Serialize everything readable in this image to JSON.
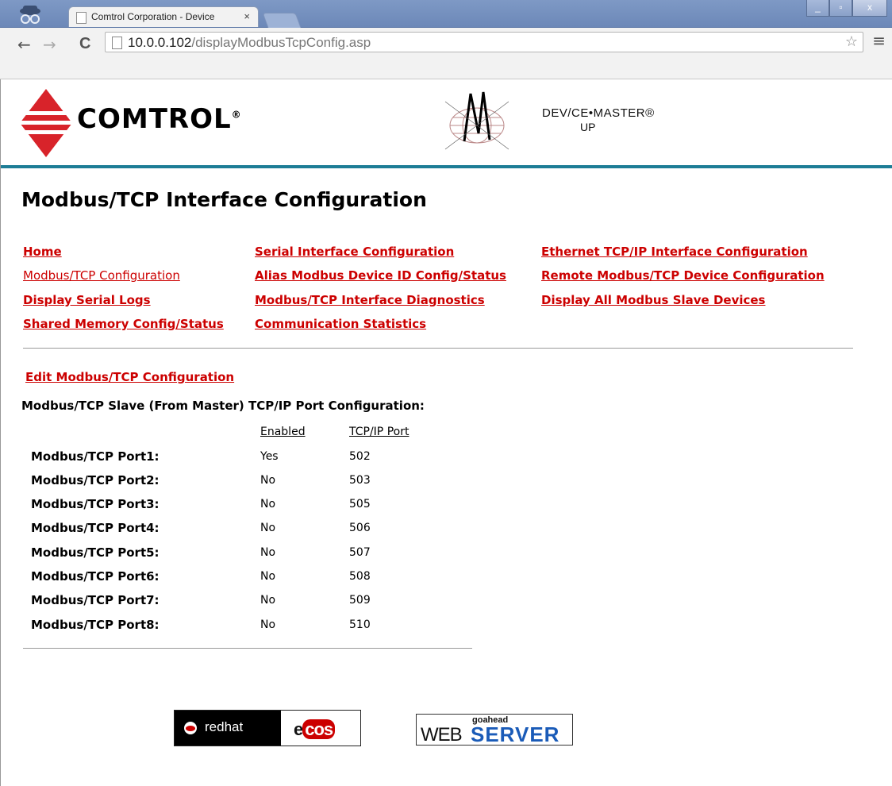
{
  "browser": {
    "tab_title": "Comtrol Corporation - Device",
    "tab_close": "×",
    "url_host": "10.0.0.102",
    "url_path": "/displayModbusTcpConfig.asp",
    "back": "←",
    "forward": "→",
    "reload": "C",
    "star": "☆",
    "menu": "≡",
    "win_min": "_",
    "win_max": "▫",
    "win_close": "x"
  },
  "header": {
    "brand": "COMTROL",
    "brand_mark": "®",
    "product_line1": "DEV/CE•MASTER®",
    "product_line2": "UP"
  },
  "page_title": "Modbus/TCP Interface Configuration",
  "nav_links": [
    {
      "label": "Home"
    },
    {
      "label": "Modbus/TCP Configuration"
    },
    {
      "label": "Display Serial Logs"
    },
    {
      "label": "Shared Memory Config/Status"
    },
    {
      "label": "Serial Interface Configuration"
    },
    {
      "label": "Alias Modbus Device ID Config/Status"
    },
    {
      "label": "Modbus/TCP Interface Diagnostics"
    },
    {
      "label": "Communication Statistics"
    },
    {
      "label": "Ethernet TCP/IP Interface Configuration"
    },
    {
      "label": "Remote Modbus/TCP Device Configuration"
    },
    {
      "label": "Display All Modbus Slave Devices"
    }
  ],
  "edit_link": "Edit Modbus/TCP Configuration",
  "section_label": "Modbus/TCP Slave (From Master) TCP/IP Port Configuration:",
  "columns": {
    "enabled": "Enabled",
    "port": "TCP/IP Port"
  },
  "ports": [
    {
      "label": "Modbus/TCP Port1:",
      "enabled": "Yes",
      "port": "502"
    },
    {
      "label": "Modbus/TCP Port2:",
      "enabled": "No",
      "port": "503"
    },
    {
      "label": "Modbus/TCP Port3:",
      "enabled": "No",
      "port": "505"
    },
    {
      "label": "Modbus/TCP Port4:",
      "enabled": "No",
      "port": "506"
    },
    {
      "label": "Modbus/TCP Port5:",
      "enabled": "No",
      "port": "507"
    },
    {
      "label": "Modbus/TCP Port6:",
      "enabled": "No",
      "port": "508"
    },
    {
      "label": "Modbus/TCP Port7:",
      "enabled": "No",
      "port": "509"
    },
    {
      "label": "Modbus/TCP Port8:",
      "enabled": "No",
      "port": "510"
    }
  ],
  "footer": {
    "redhat": "redhat",
    "ecos_e": "e",
    "ecos_cos": "cos",
    "goahead": "goahead",
    "web": "WEB",
    "server": "SERVER"
  },
  "colors": {
    "link": "#cc0000",
    "accent_rule": "#1d7d96",
    "chrome": "#6c88b8"
  }
}
